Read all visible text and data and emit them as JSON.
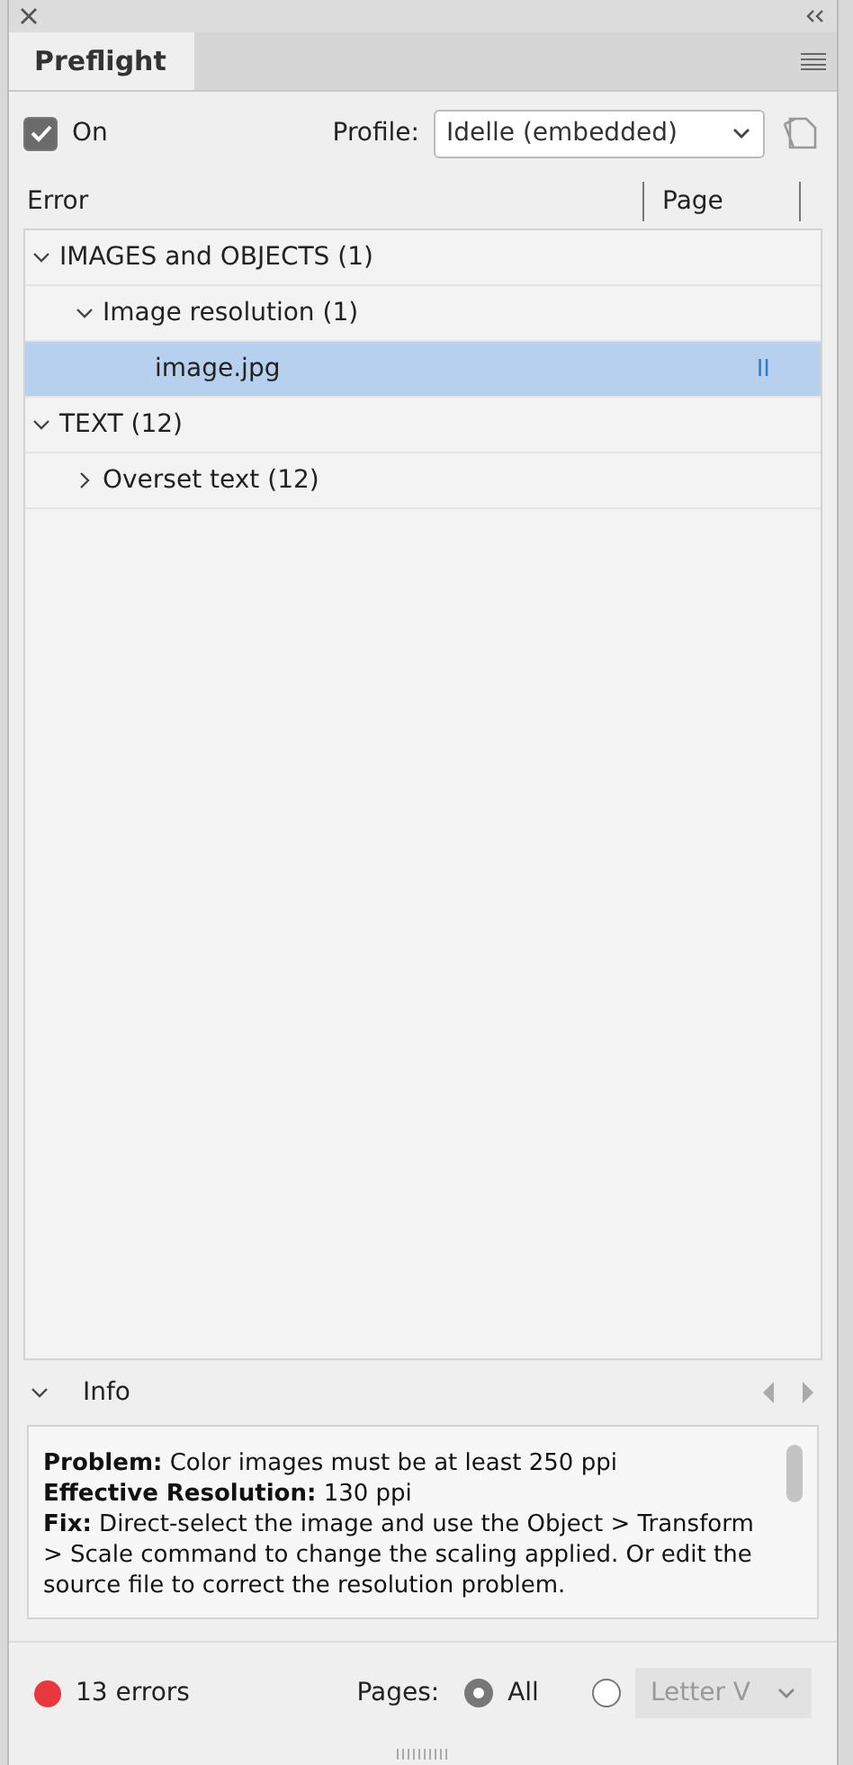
{
  "panel": {
    "title": "Preflight"
  },
  "on": {
    "label": "On",
    "checked": true
  },
  "profile": {
    "label": "Profile:",
    "value": "Idelle (embedded)"
  },
  "columns": [
    "Error",
    "Page"
  ],
  "tree": [
    {
      "label": "IMAGES and OBJECTS (1)",
      "expanded": true,
      "selected": false,
      "children": [
        {
          "label": "Image resolution (1)",
          "expanded": true,
          "selected": false,
          "children": [
            {
              "label": "image.jpg",
              "page": "II",
              "selected": true
            }
          ]
        }
      ]
    },
    {
      "label": "TEXT (12)",
      "expanded": true,
      "selected": false,
      "children": [
        {
          "label": "Overset text (12)",
          "expanded": false,
          "selected": false
        }
      ]
    }
  ],
  "info": {
    "title": "Info",
    "expanded": true,
    "lines": [
      "**Problem:** Color images must be at least 250 ppi",
      "**Effective Resolution:** 130 ppi",
      "**Fix:** Direct-select the image and use the Object > Transform > Scale command to change the scaling applied. Or edit the source file to correct the resolution problem."
    ]
  },
  "status": {
    "color": "#e8383d",
    "text": "13 errors"
  },
  "pages": {
    "label": "Pages:",
    "options": [
      {
        "label": "All",
        "selected": true,
        "kind": "plain"
      },
      {
        "label": "Letter V",
        "selected": false,
        "kind": "dropdown",
        "disabled": true
      }
    ]
  }
}
